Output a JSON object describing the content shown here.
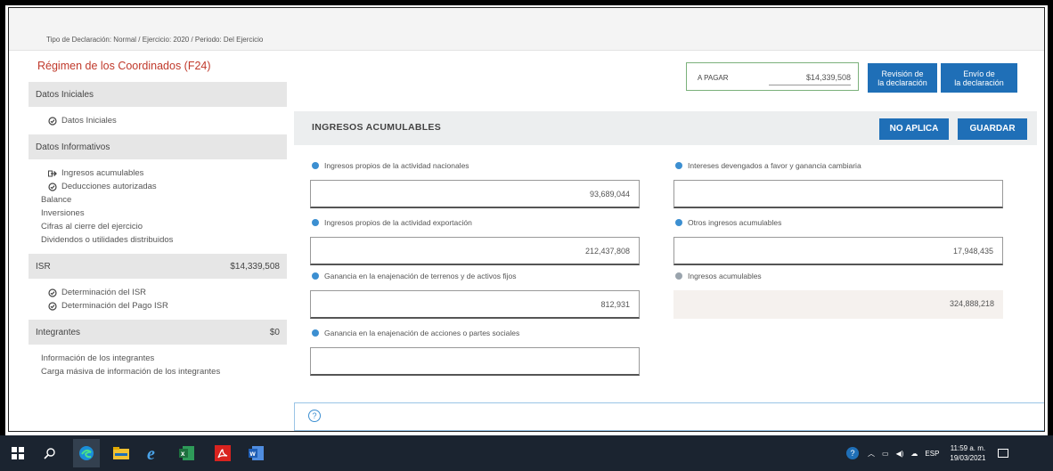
{
  "header": {
    "tipo": "Tipo de Declaración: Normal / Ejercicio: 2020 / Periodo: Del Ejercicio"
  },
  "regimen": "Régimen de los Coordinados (F24)",
  "sidebar": {
    "datos_iniciales": {
      "label": "Datos Iniciales",
      "items": [
        "Datos Iniciales"
      ]
    },
    "datos_informativos": {
      "label": "Datos Informativos",
      "items": [
        "Ingresos acumulables",
        "Deducciones autorizadas",
        "Balance",
        "Inversiones",
        "Cifras al cierre del ejercicio",
        "Dividendos o utilidades distribuidos"
      ]
    },
    "isr": {
      "label": "ISR",
      "amount": "$14,339,508",
      "items": [
        "Determinación del ISR",
        "Determinación del Pago ISR"
      ]
    },
    "integrantes": {
      "label": "Integrantes",
      "amount": "$0",
      "items": [
        "Información de los integrantes",
        "Carga másiva de información de los integrantes"
      ]
    }
  },
  "summary": {
    "label": "A PAGAR",
    "value": "$14,339,508"
  },
  "buttons": {
    "revision_1": "Revisión de",
    "revision_2": "la declaración",
    "envio_1": "Envío de",
    "envio_2": "la declaración",
    "no_aplica": "NO APLICA",
    "guardar": "GUARDAR"
  },
  "section": {
    "title": "INGRESOS ACUMULABLES"
  },
  "fields": {
    "nacionales": {
      "label": "Ingresos propios de la actividad nacionales",
      "value": "93,689,044"
    },
    "exportacion": {
      "label": "Ingresos propios de la actividad exportación",
      "value": "212,437,808"
    },
    "enajenacion": {
      "label": "Ganancia en la enajenación de terrenos y de activos fijos",
      "value": "812,931"
    },
    "acciones": {
      "label": "Ganancia en la enajenación de acciones o partes sociales",
      "value": ""
    },
    "intereses": {
      "label": "Intereses devengados a favor y ganancia cambiaria",
      "value": ""
    },
    "otros": {
      "label": "Otros ingresos acumulables",
      "value": "17,948,435"
    },
    "acumulables": {
      "label": "Ingresos acumulables",
      "value": "324,888,218"
    }
  },
  "tray": {
    "lang": "ESP",
    "time": "11:59 a. m.",
    "date": "19/03/2021"
  },
  "colors": {
    "accent": "#1f6fb7",
    "title_red": "#c0392b",
    "info": "#3c8fd1",
    "taskbar": "#1b2430"
  },
  "icons": [
    "check-circle-icon",
    "arrow-right-icon",
    "info-icon",
    "help-icon",
    "windows-icon",
    "search-icon",
    "edge-icon",
    "file-explorer-icon",
    "ie-icon",
    "excel-icon",
    "acrobat-icon",
    "word-icon"
  ]
}
